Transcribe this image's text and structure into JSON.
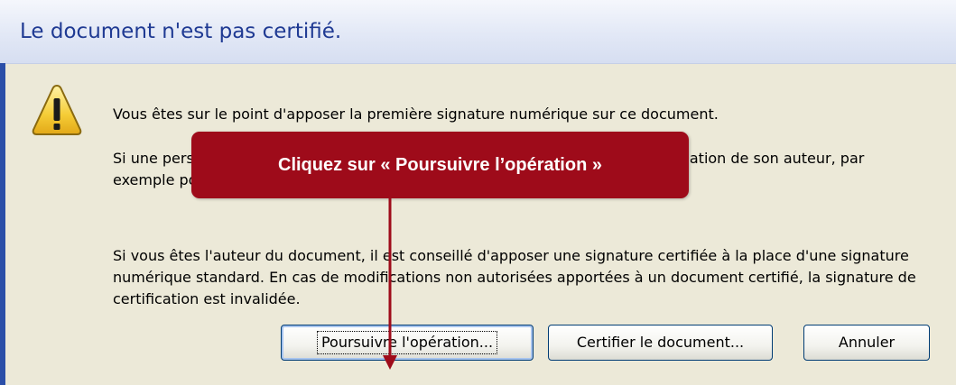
{
  "dialog": {
    "title": "Le document n'est pas certifié.",
    "icon": "warning-icon",
    "paragraphs": [
      "Vous êtes sur le point d'apposer la première signature numérique sur ce document.",
      "Si une personne ne doit pas pouvoir obtenir un document modifié sans l'autorisation de son auteur, par exemple pour un document officiel, il est préférable de ne pas le signer.",
      "Si vous êtes l'auteur du document, il est conseillé d'apposer une signature certifiée à la place d'une signature numérique standard. En cas de modifications non autorisées apportées à un document certifié, la signature de certification est invalidée."
    ],
    "buttons": {
      "continue": "Poursuivre l'opération...",
      "certify": "Certifier le document...",
      "cancel": "Annuler"
    }
  },
  "callout": {
    "text": "Cliquez sur « Poursuivre l’opération »",
    "color": "#9e0b1a"
  },
  "colors": {
    "title_text": "#1f3a93",
    "dialog_background": "#ece9d8",
    "button_border": "#003c74"
  }
}
